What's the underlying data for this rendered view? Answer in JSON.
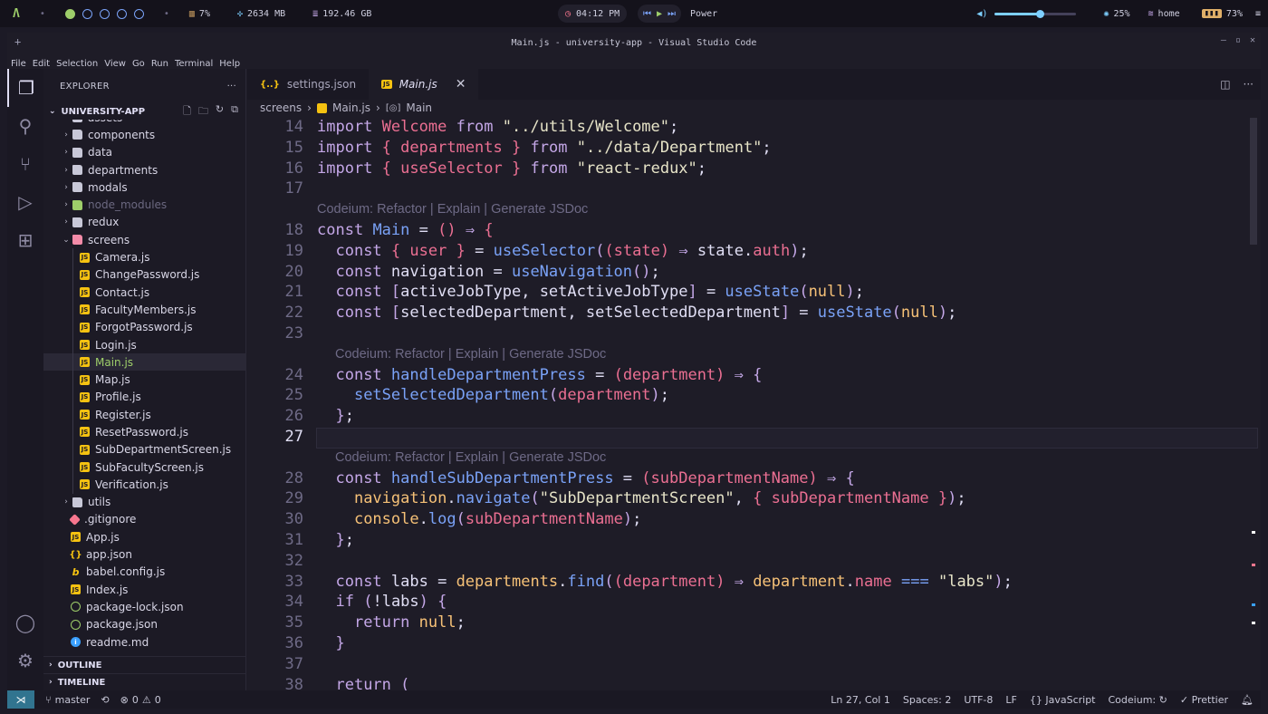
{
  "system_bar": {
    "cpu": "7%",
    "memory": "2634 MB",
    "disk": "192.46 GB",
    "clock": "04:12 PM",
    "power_label": "Power",
    "volume_percent": 55,
    "brightness": "25%",
    "wifi": "home",
    "battery": "73%"
  },
  "window": {
    "title": "Main.js - university-app - Visual Studio Code",
    "menu": [
      "File",
      "Edit",
      "Selection",
      "View",
      "Go",
      "Run",
      "Terminal",
      "Help"
    ]
  },
  "sidebar": {
    "header": "EXPLORER",
    "project": "UNIVERSITY-APP",
    "outline": "OUTLINE",
    "timeline": "TIMELINE",
    "tree": [
      {
        "label": "assets",
        "kind": "folder",
        "depth": 0,
        "partial": true
      },
      {
        "label": "components",
        "kind": "folder",
        "depth": 0
      },
      {
        "label": "data",
        "kind": "folder",
        "depth": 0
      },
      {
        "label": "departments",
        "kind": "folder",
        "depth": 0
      },
      {
        "label": "modals",
        "kind": "folder",
        "depth": 0
      },
      {
        "label": "node_modules",
        "kind": "folder-nm",
        "depth": 0,
        "dim": true
      },
      {
        "label": "redux",
        "kind": "folder",
        "depth": 0
      },
      {
        "label": "screens",
        "kind": "folder-open",
        "depth": 0,
        "open": true
      },
      {
        "label": "Camera.js",
        "kind": "js",
        "depth": 1
      },
      {
        "label": "ChangePassword.js",
        "kind": "js",
        "depth": 1
      },
      {
        "label": "Contact.js",
        "kind": "js",
        "depth": 1
      },
      {
        "label": "FacultyMembers.js",
        "kind": "js",
        "depth": 1
      },
      {
        "label": "ForgotPassword.js",
        "kind": "js",
        "depth": 1
      },
      {
        "label": "Login.js",
        "kind": "js",
        "depth": 1
      },
      {
        "label": "Main.js",
        "kind": "js",
        "depth": 1,
        "selected": true
      },
      {
        "label": "Map.js",
        "kind": "js",
        "depth": 1
      },
      {
        "label": "Profile.js",
        "kind": "js",
        "depth": 1
      },
      {
        "label": "Register.js",
        "kind": "js",
        "depth": 1
      },
      {
        "label": "ResetPassword.js",
        "kind": "js",
        "depth": 1
      },
      {
        "label": "SubDepartmentScreen.js",
        "kind": "js",
        "depth": 1
      },
      {
        "label": "SubFacultyScreen.js",
        "kind": "js",
        "depth": 1
      },
      {
        "label": "Verification.js",
        "kind": "js",
        "depth": 1
      },
      {
        "label": "utils",
        "kind": "folder",
        "depth": 0
      },
      {
        "label": ".gitignore",
        "kind": "git",
        "depth": 0,
        "file": true
      },
      {
        "label": "App.js",
        "kind": "js",
        "depth": 0,
        "file": true
      },
      {
        "label": "app.json",
        "kind": "json",
        "depth": 0,
        "file": true
      },
      {
        "label": "babel.config.js",
        "kind": "babel",
        "depth": 0,
        "file": true
      },
      {
        "label": "Index.js",
        "kind": "js",
        "depth": 0,
        "file": true
      },
      {
        "label": "package-lock.json",
        "kind": "node",
        "depth": 0,
        "file": true
      },
      {
        "label": "package.json",
        "kind": "node",
        "depth": 0,
        "file": true
      },
      {
        "label": "readme.md",
        "kind": "info",
        "depth": 0,
        "file": true
      }
    ]
  },
  "tabs": [
    {
      "label": "settings.json",
      "icon": "{..}",
      "active": false
    },
    {
      "label": "Main.js",
      "icon": "JS",
      "active": true
    }
  ],
  "breadcrumb": {
    "folder": "screens",
    "file": "Main.js",
    "symbol": "Main"
  },
  "codelens": "Codeium: Refactor | Explain | Generate JSDoc",
  "code_lines": [
    {
      "n": "14",
      "html": "<span class='kw'>import</span> <span class='id'>Welcome</span> <span class='kw'>from</span> <span class='str'>\"../utils/Welcome\"</span>;"
    },
    {
      "n": "15",
      "html": "<span class='kw'>import</span> <span class='br'>{</span> <span class='id'>departments</span> <span class='br'>}</span> <span class='kw'>from</span> <span class='str'>\"../data/Department\"</span>;"
    },
    {
      "n": "16",
      "html": "<span class='kw'>import</span> <span class='br'>{</span> <span class='id'>useSelector</span> <span class='br'>}</span> <span class='kw'>from</span> <span class='str'>\"react-redux\"</span>;"
    },
    {
      "n": "17",
      "html": ""
    },
    {
      "lens": true,
      "indent": 0
    },
    {
      "n": "18",
      "html": "<span class='kw'>const</span> <span class='fn'>Main</span> = <span class='pa'>()</span> <span class='pn'>⇒</span> <span class='br'>{</span>"
    },
    {
      "n": "19",
      "html": "  <span class='kw'>const</span> <span class='br'>{</span> <span class='id'>user</span> <span class='br'>}</span> = <span class='fn'>useSelector</span><span class='pn'>(</span><span class='pa'>(state)</span> <span class='pn'>⇒</span> state.<span class='prop'>auth</span><span class='pn'>)</span>;"
    },
    {
      "n": "20",
      "html": "  <span class='kw'>const</span> navigation = <span class='fn'>useNavigation</span><span class='pn'>()</span>;"
    },
    {
      "n": "21",
      "html": "  <span class='kw'>const</span> <span class='pn'>[</span>activeJobType, setActiveJobType<span class='pn'>]</span> = <span class='fn'>useState</span><span class='pn'>(</span><span class='nul'>null</span><span class='pn'>)</span>;"
    },
    {
      "n": "22",
      "html": "  <span class='kw'>const</span> <span class='pn'>[</span>selectedDepartment, setSelectedDepartment<span class='pn'>]</span> = <span class='fn'>useState</span><span class='pn'>(</span><span class='nul'>null</span><span class='pn'>)</span>;"
    },
    {
      "n": "23",
      "html": ""
    },
    {
      "lens": true,
      "indent": 1
    },
    {
      "n": "24",
      "html": "  <span class='kw'>const</span> <span class='fn'>handleDepartmentPress</span> = <span class='pa'>(department)</span> <span class='pn'>⇒</span> <span class='pn'>{</span>"
    },
    {
      "n": "25",
      "html": "    <span class='fn'>setSelectedDepartment</span><span class='pn'>(</span><span class='id'>department</span><span class='pn'>)</span>;"
    },
    {
      "n": "26",
      "html": "  <span class='pn'>}</span>;"
    },
    {
      "n": "27",
      "html": "",
      "current": true
    },
    {
      "lens": true,
      "indent": 1
    },
    {
      "n": "28",
      "html": "  <span class='kw'>const</span> <span class='fn'>handleSubDepartmentPress</span> = <span class='pa'>(subDepartmentName)</span> <span class='pn'>⇒</span> <span class='pn'>{</span>"
    },
    {
      "n": "29",
      "html": "    <span class='obj'>navigation</span>.<span class='fn'>navigate</span><span class='pn'>(</span><span class='str'>\"SubDepartmentScreen\"</span>, <span class='br'>{</span> <span class='id'>subDepartmentName</span> <span class='br'>}</span><span class='pn'>)</span>;"
    },
    {
      "n": "30",
      "html": "    <span class='obj'>console</span>.<span class='fn'>log</span><span class='pn'>(</span><span class='id'>subDepartmentName</span><span class='pn'>)</span>;"
    },
    {
      "n": "31",
      "html": "  <span class='pn'>}</span>;"
    },
    {
      "n": "32",
      "html": ""
    },
    {
      "n": "33",
      "html": "  <span class='kw'>const</span> labs = <span class='obj'>departments</span>.<span class='fn'>find</span><span class='pn'>(</span><span class='pa'>(department)</span> <span class='pn'>⇒</span> <span class='obj'>department</span>.<span class='prop'>name</span> <span class='fn'>===</span> <span class='str'>\"labs\"</span><span class='pn'>)</span>;"
    },
    {
      "n": "34",
      "html": "  <span class='kw'>if</span> <span class='pn'>(</span>!labs<span class='pn'>)</span> <span class='pn'>{</span>"
    },
    {
      "n": "35",
      "html": "    <span class='kw'>return</span> <span class='nul'>null</span>;"
    },
    {
      "n": "36",
      "html": "  <span class='pn'>}</span>"
    },
    {
      "n": "37",
      "html": ""
    },
    {
      "n": "38",
      "html": "  <span class='kw'>return</span> <span class='pn'>(</span>"
    }
  ],
  "status_bar": {
    "branch": "master",
    "problems": "0",
    "warnings": "0",
    "position": "Ln 27, Col 1",
    "spaces": "Spaces: 2",
    "encoding": "UTF-8",
    "eol": "LF",
    "language": "JavaScript",
    "codeium": "Codeium:",
    "prettier": "Prettier"
  },
  "colors": {
    "keyword": "#c4a7e7",
    "identifier": "#eb6f92",
    "function": "#7aa2f7",
    "string": "#e7e4c8",
    "accent_remote": "#31748f"
  }
}
